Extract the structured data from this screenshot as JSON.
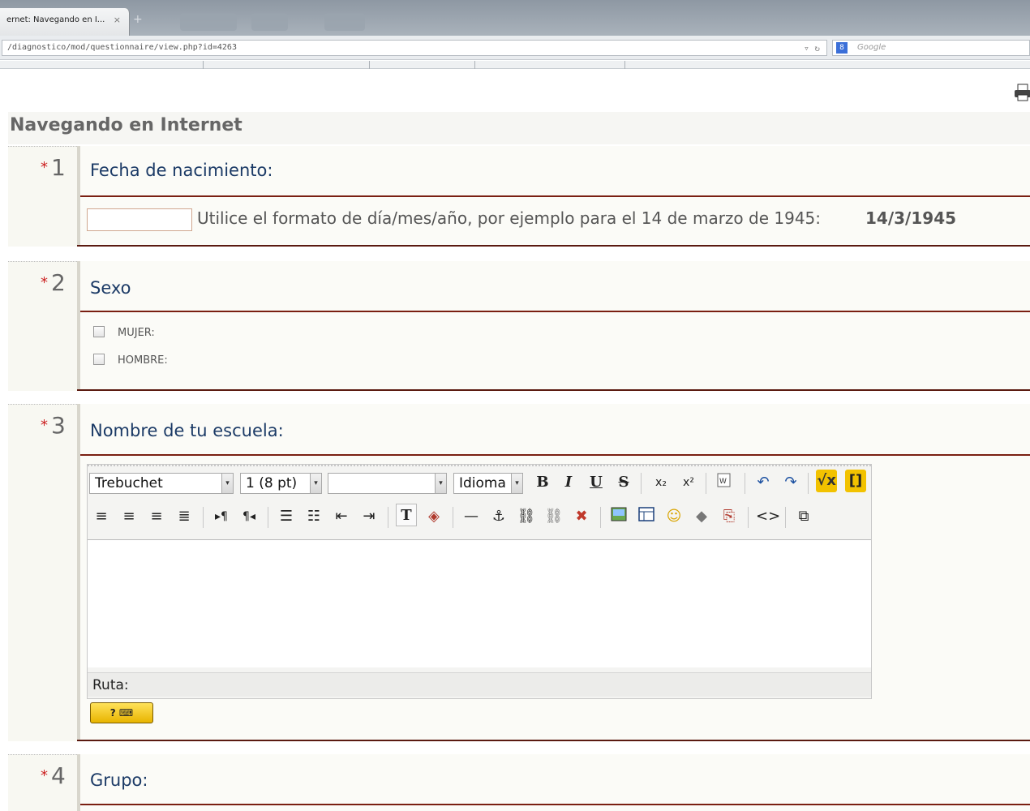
{
  "browser": {
    "tab_title": "ernet: Navegando en I...",
    "tab_close": "×",
    "new_tab": "+",
    "url": "/diagnostico/mod/questionnaire/view.php?id=4263",
    "search_placeholder": "Google",
    "search_engine_icon": "8"
  },
  "page": {
    "title": "Navegando en Internet",
    "print_icon": "printer-icon"
  },
  "questions": [
    {
      "required": "*",
      "number": "1",
      "title": "Fecha de nacimiento:",
      "date_hint": "Utilice el formato de día/mes/año, por ejemplo para el 14 de marzo de 1945:",
      "date_example": "14/3/1945"
    },
    {
      "required": "*",
      "number": "2",
      "title": "Sexo",
      "options": [
        "MUJER:",
        "HOMBRE:"
      ]
    },
    {
      "required": "*",
      "number": "3",
      "title": "Nombre de tu escuela:",
      "editor": {
        "font": "Trebuchet",
        "size": "1 (8 pt)",
        "format": "",
        "language": "Idioma",
        "path_label": "Ruta:",
        "keyboard_button": "? ⌨"
      }
    },
    {
      "required": "*",
      "number": "4",
      "title": "Grupo:"
    }
  ],
  "icons": {
    "bold": "B",
    "italic": "I",
    "underline": "U",
    "strike": "S",
    "subscript": "x₂",
    "superscript": "x²"
  }
}
